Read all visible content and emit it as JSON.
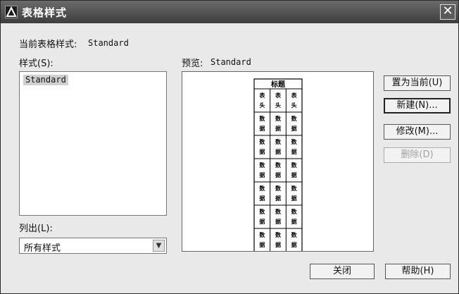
{
  "dialog": {
    "title": "表格样式",
    "close_glyph": "✕"
  },
  "current_style": {
    "label": "当前表格样式:",
    "value": "Standard"
  },
  "styles": {
    "label": "样式(S):",
    "items": [
      "Standard"
    ]
  },
  "preview": {
    "label": "预览:",
    "value": "Standard",
    "table_title": "标题",
    "header_cell": "表头",
    "data_cell": "数据"
  },
  "list_filter": {
    "label": "列出(L):",
    "selected": "所有样式"
  },
  "buttons": {
    "set_current": "置为当前(U)",
    "new": "新建(N)...",
    "modify": "修改(M)...",
    "delete": "删除(D)",
    "close": "关闭",
    "help": "帮助(H)"
  }
}
